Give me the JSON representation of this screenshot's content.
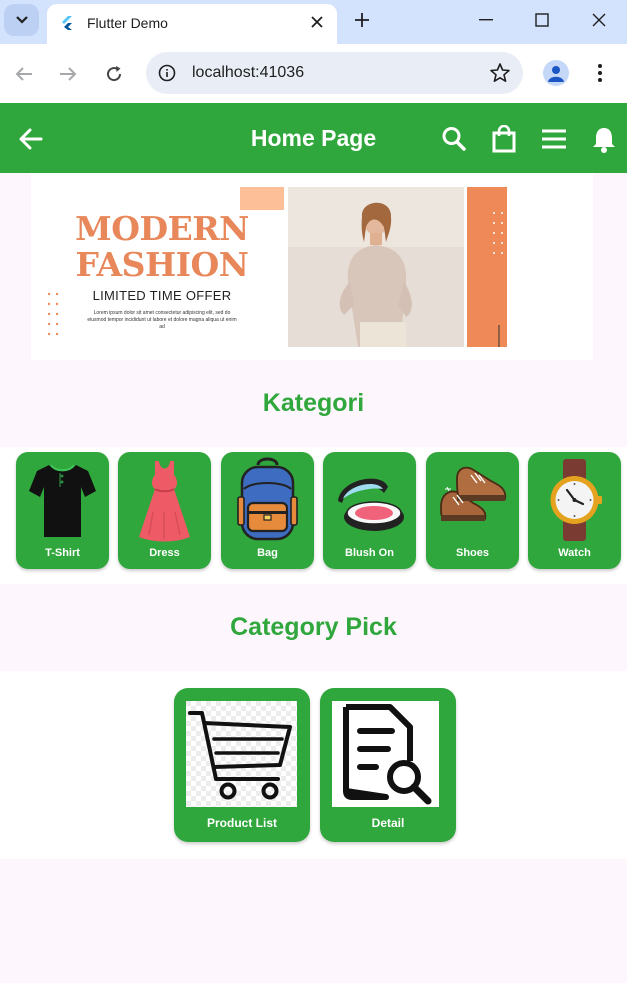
{
  "browser": {
    "tab_title": "Flutter Demo",
    "url": "localhost:41036"
  },
  "appbar": {
    "title": "Home Page",
    "color": "#30a73c"
  },
  "banner": {
    "headline_1": "MODERN",
    "headline_2": "FASHION",
    "offer": "LIMITED TIME OFFER",
    "small_text": "Lorem ipsum dolor sit amet consectetur adipiscing elit, sed do eiusmod tempor incididunt ut labore et dolore magna aliqua ut enim ad"
  },
  "sections": {
    "kategori": "Kategori",
    "category_pick": "Category Pick"
  },
  "categories": [
    {
      "label": "T-Shirt",
      "icon": "tshirt-icon"
    },
    {
      "label": "Dress",
      "icon": "dress-icon"
    },
    {
      "label": "Bag",
      "icon": "backpack-icon"
    },
    {
      "label": "Blush On",
      "icon": "blush-compact-icon"
    },
    {
      "label": "Shoes",
      "icon": "shoes-icon"
    },
    {
      "label": "Watch",
      "icon": "watch-icon"
    }
  ],
  "picks": [
    {
      "label": "Product List",
      "icon": "shopping-cart-icon"
    },
    {
      "label": "Detail",
      "icon": "document-search-icon"
    }
  ]
}
